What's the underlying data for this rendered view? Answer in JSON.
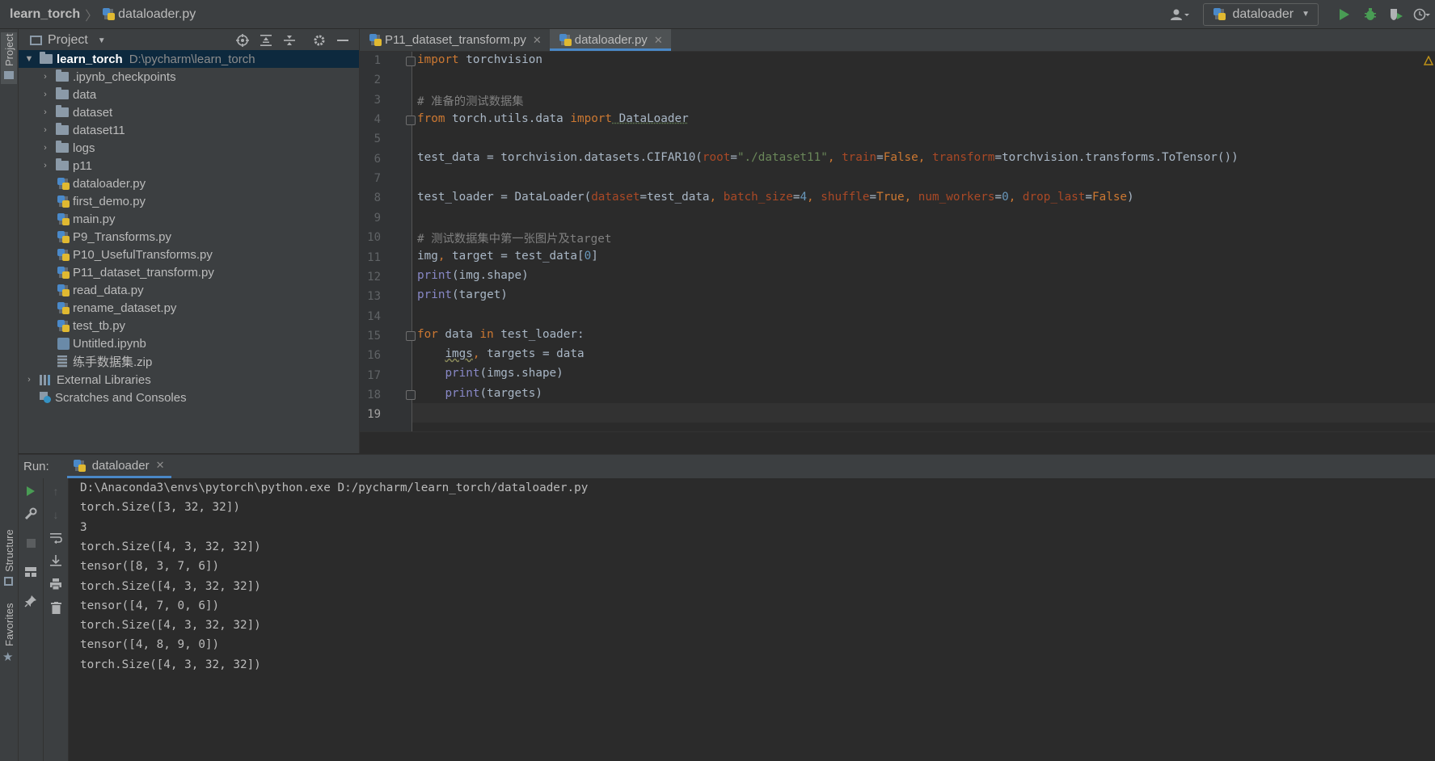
{
  "navbar": {
    "project": "learn_torch",
    "file": "dataloader.py",
    "run_config": "dataloader"
  },
  "left_strip": {
    "project_tab": "Project",
    "structure_tab": "Structure",
    "favorites_tab": "Favorites"
  },
  "project_panel": {
    "title": "Project",
    "root_name": "learn_torch",
    "root_path": "D:\\pycharm\\learn_torch",
    "items": [
      {
        "label": ".ipynb_checkpoints",
        "kind": "folder"
      },
      {
        "label": "data",
        "kind": "folder"
      },
      {
        "label": "dataset",
        "kind": "folder"
      },
      {
        "label": "dataset11",
        "kind": "folder"
      },
      {
        "label": "logs",
        "kind": "folder"
      },
      {
        "label": "p11",
        "kind": "folder"
      },
      {
        "label": "dataloader.py",
        "kind": "python"
      },
      {
        "label": "first_demo.py",
        "kind": "python"
      },
      {
        "label": "main.py",
        "kind": "python"
      },
      {
        "label": "P9_Transforms.py",
        "kind": "python"
      },
      {
        "label": "P10_UsefulTransforms.py",
        "kind": "python"
      },
      {
        "label": "P11_dataset_transform.py",
        "kind": "python"
      },
      {
        "label": "read_data.py",
        "kind": "python"
      },
      {
        "label": "rename_dataset.py",
        "kind": "python"
      },
      {
        "label": "test_tb.py",
        "kind": "python"
      },
      {
        "label": "Untitled.ipynb",
        "kind": "notebook"
      },
      {
        "label": "练手数据集.zip",
        "kind": "zip"
      }
    ],
    "external_libraries": "External Libraries",
    "scratches": "Scratches and Consoles"
  },
  "editor_tabs": [
    {
      "label": "P11_dataset_transform.py",
      "active": false
    },
    {
      "label": "dataloader.py",
      "active": true
    }
  ],
  "editor": {
    "line_numbers": [
      "1",
      "2",
      "3",
      "4",
      "5",
      "6",
      "7",
      "8",
      "9",
      "10",
      "11",
      "12",
      "13",
      "14",
      "15",
      "16",
      "17",
      "18",
      "19"
    ],
    "lines": {
      "l1": {
        "kw": "import",
        "rest": " torchvision"
      },
      "l3": "# 准备的测试数据集",
      "l4": {
        "kw1": "from",
        "mid": " torch.utils.data ",
        "kw2": "import",
        "rest": " DataLoader"
      },
      "l6": {
        "a": "test_data = torchvision.datasets.CIFAR10(",
        "p1": "root",
        "eq1": "=",
        "s1": "\"./dataset11\"",
        "c1": ", ",
        "p2": "train",
        "eq2": "=",
        "v2": "False",
        "c2": ", ",
        "p3": "transform",
        "eq3": "=",
        "rest": "torchvision.transforms.ToTensor())"
      },
      "l8": {
        "a": "test_loader = DataLoader(",
        "p1": "dataset",
        "eq1": "=",
        "v1": "test_data",
        "c1": ", ",
        "p2": "batch_size",
        "eq2": "=",
        "n2": "4",
        "c2": ", ",
        "p3": "shuffle",
        "eq3": "=",
        "v3": "True",
        "c3": ", ",
        "p4": "num_workers",
        "eq4": "=",
        "n4": "0",
        "c4": ", ",
        "p5": "drop_last",
        "eq5": "=",
        "v5": "False",
        "end": ")"
      },
      "l10": "# 测试数据集中第一张图片及target",
      "l11": {
        "a": "img",
        "c": ", ",
        "b": "target = test_data[",
        "n": "0",
        "end": "]"
      },
      "l12": {
        "fn": "print",
        "rest": "(img.shape)"
      },
      "l13": {
        "fn": "print",
        "rest": "(target)"
      },
      "l15": {
        "kw1": "for",
        "mid": " data ",
        "kw2": "in",
        "rest": " test_loader:"
      },
      "l16": {
        "indent": "    ",
        "a": "imgs",
        "c": ", ",
        "b": "targets = data"
      },
      "l17": {
        "indent": "    ",
        "fn": "print",
        "rest": "(imgs.shape)"
      },
      "l18": {
        "indent": "    ",
        "fn": "print",
        "rest": "(targets)"
      }
    }
  },
  "run_panel": {
    "label": "Run:",
    "tab": "dataloader",
    "console": [
      "D:\\Anaconda3\\envs\\pytorch\\python.exe D:/pycharm/learn_torch/dataloader.py",
      "torch.Size([3, 32, 32])",
      "3",
      "torch.Size([4, 3, 32, 32])",
      "tensor([8, 3, 7, 6])",
      "torch.Size([4, 3, 32, 32])",
      "tensor([4, 7, 0, 6])",
      "torch.Size([4, 3, 32, 32])",
      "tensor([4, 8, 9, 0])",
      "torch.Size([4, 3, 32, 32])"
    ]
  },
  "colors": {
    "keyword": "#cc7832",
    "comment": "#808080",
    "string": "#6a8759",
    "number": "#6897bb",
    "param": "#aa4926",
    "builtin": "#8888c6",
    "run_green": "#499c54",
    "selection": "#0d293e",
    "accent": "#4a88c7"
  }
}
